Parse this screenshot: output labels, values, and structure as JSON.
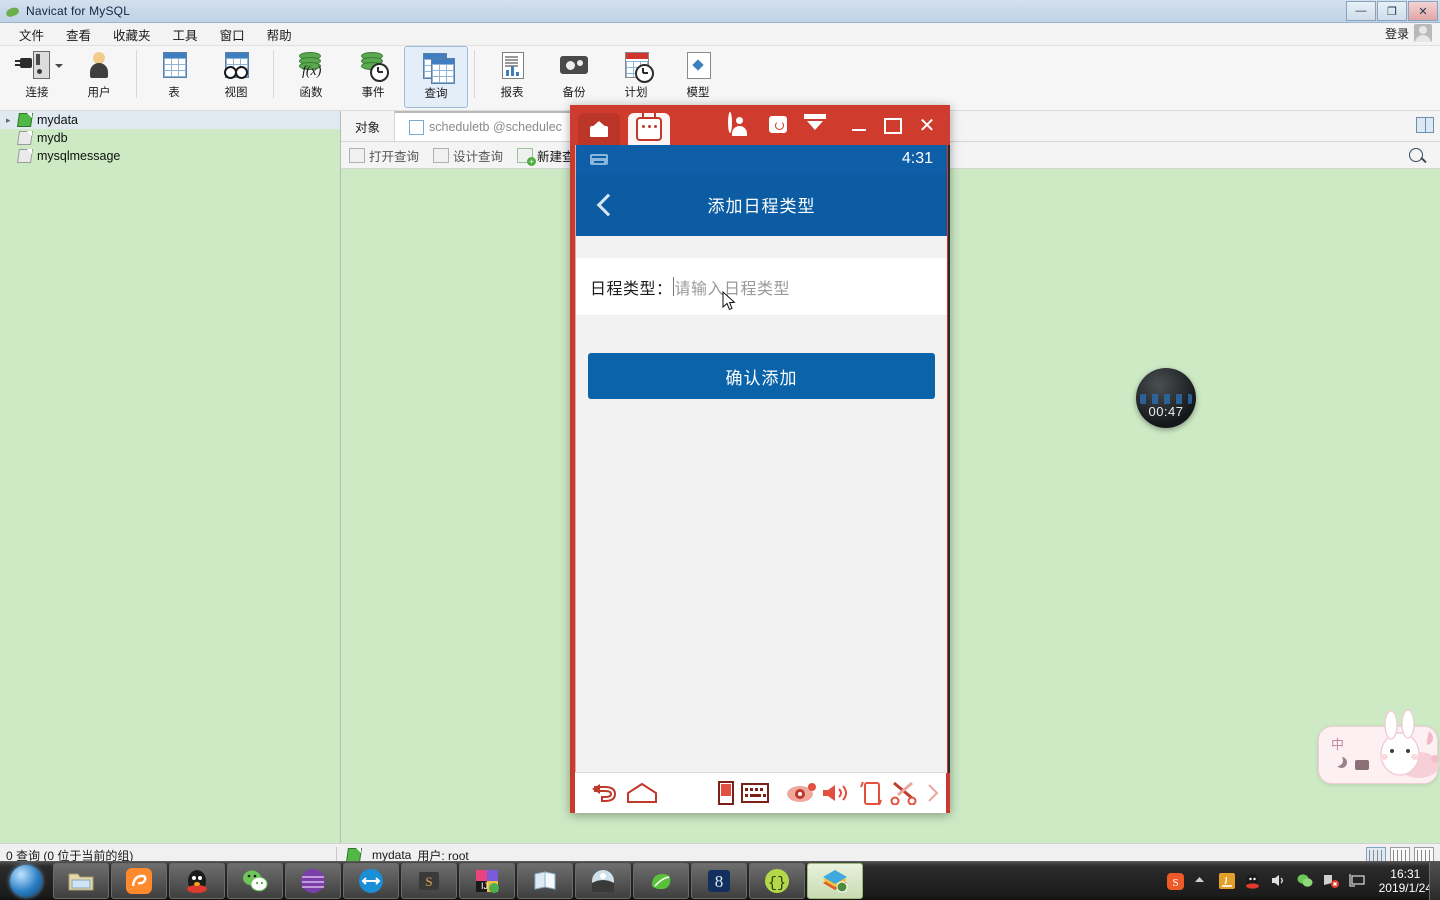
{
  "navicat": {
    "title": "Navicat for MySQL",
    "login_label": "登录",
    "window_controls": {
      "minimize": "—",
      "maximize": "❐",
      "close": "✕"
    },
    "menu": [
      "文件",
      "查看",
      "收藏夹",
      "工具",
      "窗口",
      "帮助"
    ],
    "toolbar": [
      {
        "label": "连接",
        "icon": "connection-icon",
        "selected": false
      },
      {
        "label": "用户",
        "icon": "user-icon",
        "selected": false
      },
      {
        "label": "表",
        "icon": "table-icon",
        "selected": false
      },
      {
        "label": "视图",
        "icon": "view-icon",
        "selected": false
      },
      {
        "label": "函数",
        "icon": "function-icon",
        "selected": false
      },
      {
        "label": "事件",
        "icon": "event-icon",
        "selected": false
      },
      {
        "label": "查询",
        "icon": "query-icon",
        "selected": true
      },
      {
        "label": "报表",
        "icon": "report-icon",
        "selected": false
      },
      {
        "label": "备份",
        "icon": "backup-icon",
        "selected": false
      },
      {
        "label": "计划",
        "icon": "schedule-icon",
        "selected": false
      },
      {
        "label": "模型",
        "icon": "model-icon",
        "selected": false
      }
    ],
    "connections": [
      {
        "name": "mydata",
        "selected": true,
        "expandable": true,
        "connected": true
      },
      {
        "name": "mydb",
        "selected": false,
        "expandable": false,
        "connected": false
      },
      {
        "name": "mysqlmessage",
        "selected": false,
        "expandable": false,
        "connected": false
      }
    ],
    "tabs": [
      {
        "label": "对象",
        "type": "object"
      },
      {
        "label": "scheduletb @schedulec",
        "type": "document"
      }
    ],
    "object_toolbar": [
      {
        "label": "打开查询",
        "icon": "open-query-icon",
        "enabled": false
      },
      {
        "label": "设计查询",
        "icon": "design-query-icon",
        "enabled": false
      },
      {
        "label": "新建查询",
        "icon": "new-query-icon",
        "enabled": true
      }
    ],
    "statusbar": {
      "left": "0 查询 (0 位于当前的组)",
      "connection": "mydata",
      "user": "用户: root"
    }
  },
  "mirror": {
    "tabs": [
      {
        "icon": "home-icon",
        "active": false
      },
      {
        "icon": "device-icon",
        "active": true
      }
    ],
    "actions": [
      {
        "icon": "account-icon"
      },
      {
        "icon": "skin-icon"
      },
      {
        "icon": "funnel-icon"
      }
    ],
    "window_controls": {
      "minimize": "—",
      "maximize": "□",
      "close": "✕"
    },
    "phone": {
      "status_time": "4:31",
      "status_icon": "keyboard-icon",
      "back_icon": "chevron-left-icon",
      "app_title": "添加日程类型",
      "field_label": "日程类型：",
      "field_value": "",
      "field_placeholder": "请输入日程类型",
      "submit_label": "确认添加"
    },
    "bottom_toolbar": [
      {
        "icon": "back-arrow-icon"
      },
      {
        "icon": "home-outline-icon"
      },
      {
        "icon": "screen-icon"
      },
      {
        "icon": "keyboard-icon"
      },
      {
        "icon": "eye-icon"
      },
      {
        "icon": "volume-icon"
      },
      {
        "icon": "rotate-icon"
      },
      {
        "icon": "scissors-icon"
      },
      {
        "icon": "chevron-right-icon"
      }
    ]
  },
  "desktop": {
    "clock_widget": {
      "value": "00:47"
    },
    "ime_bar": {
      "mode": "中",
      "moon_icon": "moon-icon",
      "keyboard_icon": "keyboard-icon"
    }
  },
  "taskbar": {
    "start_icon": "windows-start-icon",
    "buttons": [
      {
        "icon": "explorer-icon",
        "active": false
      },
      {
        "icon": "uc-browser-icon",
        "active": false
      },
      {
        "icon": "qq-icon",
        "active": false
      },
      {
        "icon": "wechat-icon",
        "active": false
      },
      {
        "icon": "purple-app-icon",
        "active": false
      },
      {
        "icon": "teamviewer-icon",
        "active": false
      },
      {
        "icon": "sublime-icon",
        "active": false
      },
      {
        "icon": "intellij-icon",
        "active": false
      },
      {
        "icon": "notepad-icon",
        "active": false
      },
      {
        "icon": "globe-icon",
        "active": false
      },
      {
        "icon": "green-leaf-icon",
        "active": false
      },
      {
        "icon": "vs-icon",
        "active": false
      },
      {
        "icon": "braces-icon",
        "active": false
      },
      {
        "icon": "navicat-icon",
        "active": true
      }
    ],
    "tray": [
      {
        "icon": "sogou-icon"
      },
      {
        "icon": "chevron-up-icon"
      },
      {
        "icon": "java-icon"
      },
      {
        "icon": "qq-icon"
      },
      {
        "icon": "volume-icon"
      },
      {
        "icon": "wechat-icon"
      },
      {
        "icon": "network-error-icon"
      },
      {
        "icon": "monitor-icon"
      }
    ],
    "clock": {
      "time": "16:31",
      "date": "2019/1/24"
    }
  }
}
